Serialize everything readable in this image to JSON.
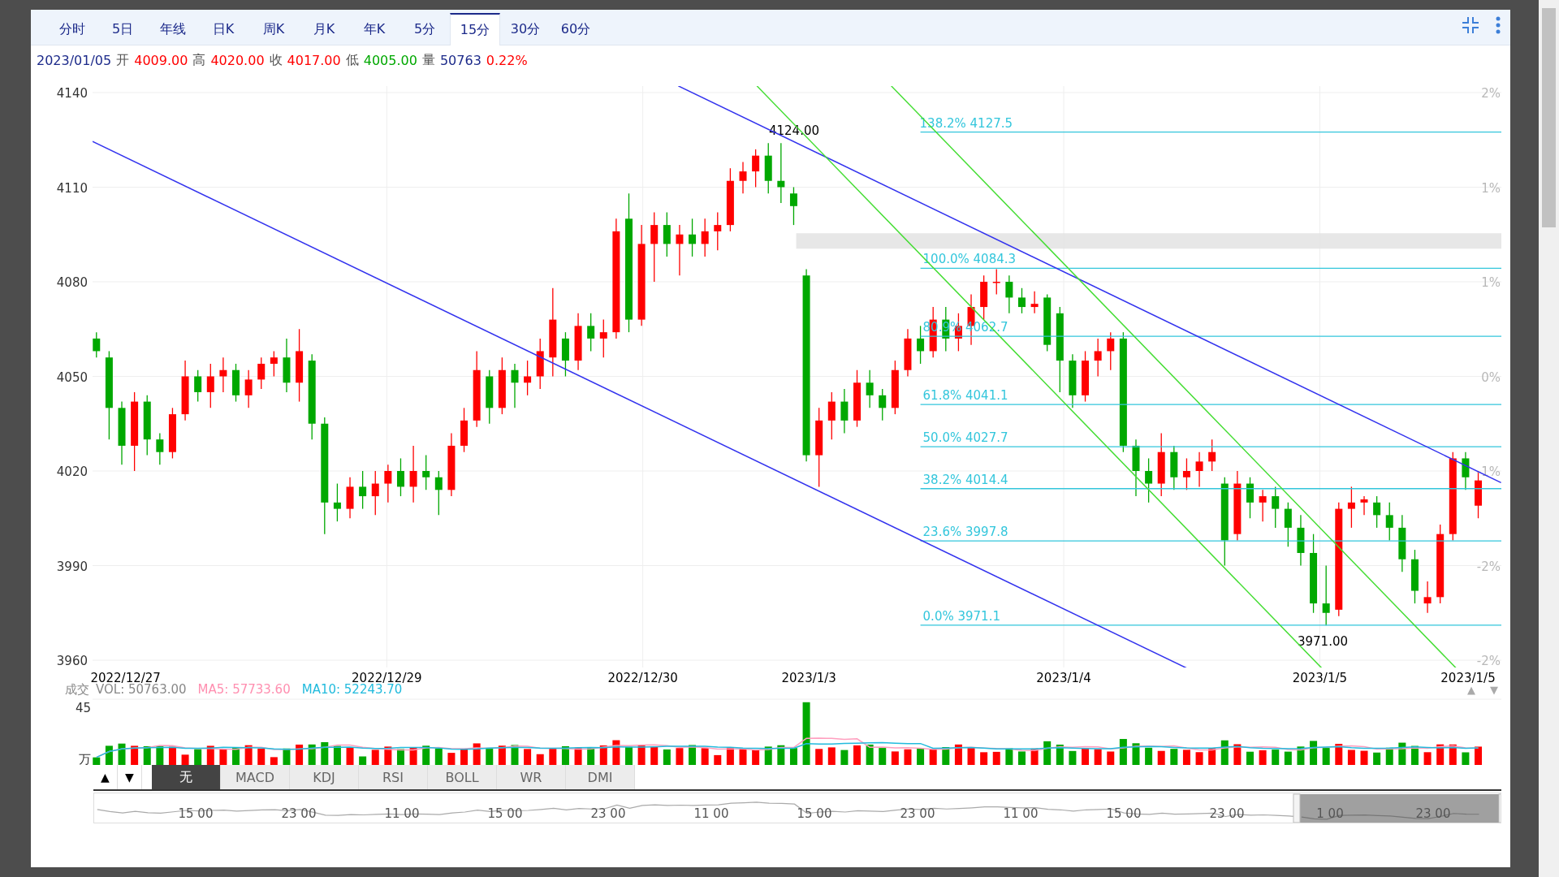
{
  "tabs": [
    {
      "label": "分时",
      "selected": false
    },
    {
      "label": "5日",
      "selected": false
    },
    {
      "label": "年线",
      "selected": false
    },
    {
      "label": "日K",
      "selected": false
    },
    {
      "label": "周K",
      "selected": false
    },
    {
      "label": "月K",
      "selected": false
    },
    {
      "label": "年K",
      "selected": false
    },
    {
      "label": "5分",
      "selected": false
    },
    {
      "label": "15分",
      "selected": true
    },
    {
      "label": "30分",
      "selected": false
    },
    {
      "label": "60分",
      "selected": false
    }
  ],
  "quote": {
    "date": "2023/01/05",
    "fields": [
      {
        "label": "开",
        "value": "4009.00",
        "color": "#ff0000"
      },
      {
        "label": "高",
        "value": "4020.00",
        "color": "#ff0000"
      },
      {
        "label": "收",
        "value": "4017.00",
        "color": "#ff0000"
      },
      {
        "label": "低",
        "value": "4005.00",
        "color": "#00a800"
      },
      {
        "label": "量",
        "value": "50763",
        "color": "#1c2a8a"
      }
    ],
    "change": {
      "value": "0.22%",
      "color": "#ff0000"
    }
  },
  "price_chart": {
    "chart_data": {
      "type": "candlestick",
      "ylim": [
        3960,
        4140
      ],
      "yticks": [
        4140,
        4110,
        4080,
        4050,
        4020,
        3990,
        3960
      ],
      "grid": true,
      "ohlc": [
        [
          4062,
          4064,
          4056,
          4058
        ],
        [
          4056,
          4058,
          4030,
          4040
        ],
        [
          4040,
          4042,
          4022,
          4028
        ],
        [
          4028,
          4045,
          4020,
          4042
        ],
        [
          4042,
          4044,
          4025,
          4030
        ],
        [
          4030,
          4032,
          4022,
          4026
        ],
        [
          4026,
          4040,
          4024,
          4038
        ],
        [
          4038,
          4055,
          4036,
          4050
        ],
        [
          4050,
          4052,
          4042,
          4045
        ],
        [
          4045,
          4054,
          4040,
          4050
        ],
        [
          4050,
          4056,
          4045,
          4052
        ],
        [
          4052,
          4054,
          4042,
          4044
        ],
        [
          4044,
          4052,
          4040,
          4049
        ],
        [
          4049,
          4056,
          4046,
          4054
        ],
        [
          4054,
          4058,
          4050,
          4056
        ],
        [
          4056,
          4062,
          4045,
          4048
        ],
        [
          4048,
          4065,
          4042,
          4058
        ],
        [
          4055,
          4057,
          4030,
          4035
        ],
        [
          4035,
          4037,
          4000,
          4010
        ],
        [
          4010,
          4016,
          4004,
          4008
        ],
        [
          4008,
          4018,
          4005,
          4015
        ],
        [
          4015,
          4020,
          4008,
          4012
        ],
        [
          4012,
          4020,
          4006,
          4016
        ],
        [
          4016,
          4022,
          4010,
          4020
        ],
        [
          4020,
          4024,
          4012,
          4015
        ],
        [
          4015,
          4028,
          4010,
          4020
        ],
        [
          4020,
          4025,
          4014,
          4018
        ],
        [
          4018,
          4020,
          4006,
          4014
        ],
        [
          4014,
          4032,
          4012,
          4028
        ],
        [
          4028,
          4040,
          4026,
          4036
        ],
        [
          4036,
          4058,
          4034,
          4052
        ],
        [
          4050,
          4052,
          4035,
          4040
        ],
        [
          4040,
          4056,
          4038,
          4052
        ],
        [
          4052,
          4054,
          4040,
          4048
        ],
        [
          4048,
          4055,
          4044,
          4050
        ],
        [
          4050,
          4062,
          4046,
          4058
        ],
        [
          4056,
          4078,
          4050,
          4068
        ],
        [
          4062,
          4064,
          4050,
          4055
        ],
        [
          4055,
          4070,
          4052,
          4066
        ],
        [
          4066,
          4070,
          4058,
          4062
        ],
        [
          4062,
          4068,
          4056,
          4064
        ],
        [
          4064,
          4100,
          4062,
          4096
        ],
        [
          4100,
          4108,
          4064,
          4068
        ],
        [
          4068,
          4098,
          4066,
          4092
        ],
        [
          4092,
          4102,
          4080,
          4098
        ],
        [
          4098,
          4102,
          4088,
          4092
        ],
        [
          4092,
          4098,
          4082,
          4095
        ],
        [
          4095,
          4100,
          4088,
          4092
        ],
        [
          4092,
          4100,
          4088,
          4096
        ],
        [
          4096,
          4102,
          4090,
          4098
        ],
        [
          4098,
          4116,
          4096,
          4112
        ],
        [
          4112,
          4118,
          4108,
          4115
        ],
        [
          4115,
          4122,
          4110,
          4120
        ],
        [
          4120,
          4124,
          4108,
          4112
        ],
        [
          4112,
          4124,
          4105,
          4110
        ],
        [
          4108,
          4110,
          4098,
          4104
        ],
        [
          4082,
          4084,
          4023,
          4025
        ],
        [
          4025,
          4040,
          4015,
          4036
        ],
        [
          4036,
          4045,
          4030,
          4042
        ],
        [
          4042,
          4046,
          4032,
          4036
        ],
        [
          4036,
          4052,
          4034,
          4048
        ],
        [
          4048,
          4052,
          4040,
          4044
        ],
        [
          4044,
          4046,
          4036,
          4040
        ],
        [
          4040,
          4055,
          4038,
          4052
        ],
        [
          4052,
          4065,
          4050,
          4062
        ],
        [
          4062,
          4066,
          4054,
          4058
        ],
        [
          4058,
          4072,
          4056,
          4068
        ],
        [
          4068,
          4072,
          4058,
          4062
        ],
        [
          4062,
          4070,
          4058,
          4066
        ],
        [
          4066,
          4076,
          4060,
          4072
        ],
        [
          4072,
          4082,
          4068,
          4080
        ],
        [
          4080,
          4084,
          4076,
          4080
        ],
        [
          4080,
          4082,
          4070,
          4075
        ],
        [
          4075,
          4078,
          4070,
          4072
        ],
        [
          4072,
          4077,
          4070,
          4073
        ],
        [
          4075,
          4076,
          4058,
          4060
        ],
        [
          4070,
          4072,
          4045,
          4055
        ],
        [
          4055,
          4057,
          4040,
          4044
        ],
        [
          4044,
          4058,
          4042,
          4055
        ],
        [
          4055,
          4062,
          4050,
          4058
        ],
        [
          4058,
          4064,
          4052,
          4062
        ],
        [
          4062,
          4064,
          4026,
          4028
        ],
        [
          4028,
          4030,
          4012,
          4020
        ],
        [
          4020,
          4024,
          4010,
          4016
        ],
        [
          4016,
          4032,
          4012,
          4026
        ],
        [
          4026,
          4028,
          4014,
          4018
        ],
        [
          4018,
          4024,
          4014,
          4020
        ],
        [
          4020,
          4026,
          4015,
          4023
        ],
        [
          4023,
          4030,
          4020,
          4026
        ],
        [
          4016,
          4018,
          3990,
          3998
        ],
        [
          4000,
          4020,
          3998,
          4016
        ],
        [
          4016,
          4018,
          4005,
          4010
        ],
        [
          4010,
          4014,
          4004,
          4012
        ],
        [
          4012,
          4015,
          4002,
          4008
        ],
        [
          4008,
          4010,
          3996,
          4002
        ],
        [
          4002,
          4006,
          3990,
          3994
        ],
        [
          3994,
          4000,
          3975,
          3978
        ],
        [
          3978,
          3990,
          3971,
          3975
        ],
        [
          3976,
          4010,
          3974,
          4008
        ],
        [
          4008,
          4015,
          4002,
          4010
        ],
        [
          4010,
          4012,
          4006,
          4011
        ],
        [
          4010,
          4012,
          4002,
          4006
        ],
        [
          4006,
          4010,
          3998,
          4002
        ],
        [
          4002,
          4006,
          3988,
          3992
        ],
        [
          3992,
          3995,
          3978,
          3982
        ],
        [
          3978,
          3985,
          3975,
          3980
        ],
        [
          3980,
          4003,
          3978,
          4000
        ],
        [
          4000,
          4026,
          3998,
          4024
        ],
        [
          4024,
          4026,
          4014,
          4018
        ],
        [
          4009,
          4020,
          4005,
          4017
        ]
      ]
    },
    "right_labels": [
      "2%",
      "1%",
      "1%",
      "0%",
      "-1%",
      "-2%",
      "-2%"
    ],
    "fib_levels": [
      {
        "label": "138.2% 4127.5"
      },
      {
        "label": "100.0% 4084.3"
      },
      {
        "label": "80.9% 4062.7"
      },
      {
        "label": "61.8% 4041.1"
      },
      {
        "label": "50.0% 4027.7"
      },
      {
        "label": "38.2% 4014.4"
      },
      {
        "label": "23.6% 3997.8"
      },
      {
        "label": "0.0% 3971.1"
      }
    ],
    "date_labels": [
      "2022/12/27",
      "2022/12/29",
      "2022/12/30",
      "2023/1/3",
      "2023/1/4",
      "2023/1/5",
      "2023/1/5"
    ],
    "high_marker": "4124.00",
    "low_marker": "3971.00"
  },
  "volume": {
    "title": "成交",
    "vol": "VOL: 50763.00",
    "ma5": "MA5: 57733.60",
    "ma10": "MA10: 52243.70",
    "max_label": "45",
    "unit_label": "万",
    "zoom_up": "▲",
    "zoom_down": "▼"
  },
  "indicators": {
    "up": "▲",
    "down": "▼",
    "tabs": [
      {
        "label": "无",
        "selected": true
      },
      {
        "label": "MACD",
        "selected": false
      },
      {
        "label": "KDJ",
        "selected": false
      },
      {
        "label": "RSI",
        "selected": false
      },
      {
        "label": "BOLL",
        "selected": false
      },
      {
        "label": "WR",
        "selected": false
      },
      {
        "label": "DMI",
        "selected": false
      }
    ]
  },
  "navigator": {
    "labels": [
      "15 00",
      "23 00",
      "11 00",
      "15 00",
      "23 00",
      "11 00",
      "15 00",
      "23 00",
      "11 00",
      "15 00",
      "23 00",
      "1 00",
      "23 00"
    ]
  }
}
